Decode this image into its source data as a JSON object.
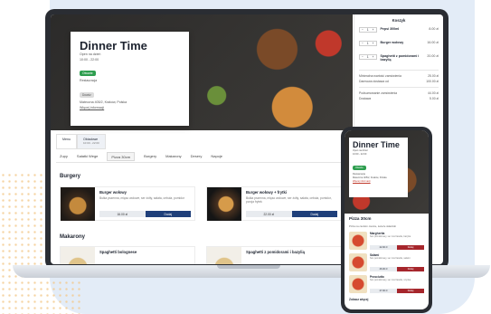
{
  "restaurant": {
    "name": "Dinner Time",
    "status_text": "Open na dzień",
    "hours": "10:00 - 22:00",
    "open_badge": "Otwarte",
    "type": "Restauracja",
    "delivery_badge": "Dowóz",
    "address": "Mateczna 405/2, Kraków, Polska",
    "more_info": "Więcej informacji"
  },
  "cart": {
    "title": "Koszyk",
    "items": [
      {
        "qty": "1",
        "name": "Pepsi 300ml",
        "price": "8.00 zł"
      },
      {
        "qty": "1",
        "name": "Burger wołowy",
        "price": "16.00 zł"
      },
      {
        "qty": "1",
        "name": "Spaghetti z pomidorami i bazylią",
        "price": "20.00 zł"
      }
    ],
    "lines": [
      {
        "label": "Minimalna wartość zamówienia",
        "value": "25.00 zł"
      },
      {
        "label": "Darmowa dostawa od",
        "value": "100.00 zł"
      }
    ],
    "subtotal_label": "Podsumowanie zamówienia",
    "subtotal_value": "44.00 zł",
    "delivery_label": "Dostawa",
    "delivery_value": "5.00 zł"
  },
  "menu_tabs": [
    {
      "label": "Menu",
      "sub": ""
    },
    {
      "label": "Obiadowe",
      "sub": "10:00 - 22:00"
    }
  ],
  "categories": [
    "Zupy",
    "Sałatki Wege",
    "Pizza 30cm",
    "Burgery",
    "Makarony",
    "Desery",
    "Napoje"
  ],
  "sections": [
    {
      "title": "Burgery",
      "dishes": [
        {
          "name": "Burger wołowy",
          "desc": "Bułka pszenna, mięso wołowe, ser żółty, sałata, cebula, pomidor",
          "price": "16.00 zł",
          "add": "Dodaj"
        },
        {
          "name": "Burger wołowy + frytki",
          "desc": "Bułka pszenna, mięso wołowe, ser żółty, sałata, cebula, pomidor, porcja frytek",
          "price": "22.00 zł",
          "add": "Dodaj"
        }
      ]
    },
    {
      "title": "Makarony",
      "dishes": [
        {
          "name": "Spaghetti bolognese"
        },
        {
          "name": "Spaghetti z pomidorami i bazylią"
        }
      ]
    }
  ],
  "phone": {
    "section": "Pizza 30cm",
    "info": "Pizza na cienkim cieście, świeże składniki",
    "items": [
      {
        "name": "Margherita",
        "desc": "Sos pomidorowy, ser mozzarella, bazylia",
        "price": "22.00 zł",
        "add": "Dodaj"
      },
      {
        "name": "Salami",
        "desc": "Sos pomidorowy, ser mozzarella, salami",
        "price": "26.00 zł",
        "add": "Dodaj"
      },
      {
        "name": "Prosciutto",
        "desc": "Sos pomidorowy, ser mozzarella, szynka",
        "price": "27.00 zł",
        "add": "Dodaj"
      }
    ],
    "more": "Zobacz więcej"
  }
}
